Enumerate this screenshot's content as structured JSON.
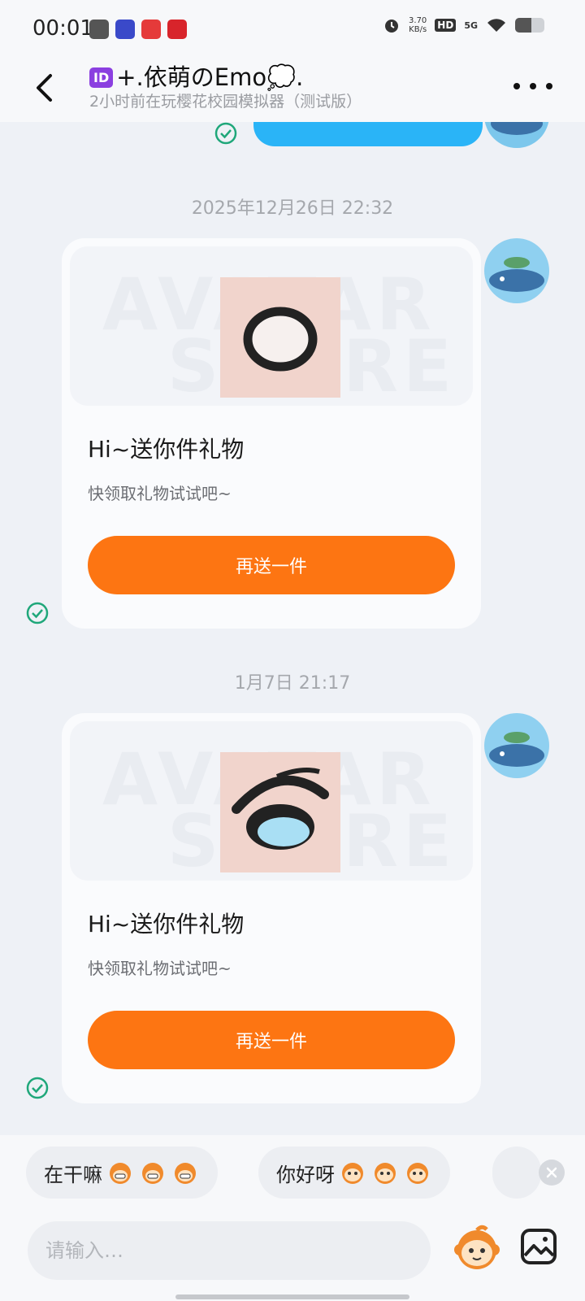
{
  "status_bar": {
    "time": "00:01",
    "net_speed_value": "3.70",
    "net_speed_unit": "KB/s",
    "hd": "HD",
    "signal": "5G",
    "battery_level": 0.55
  },
  "header": {
    "id_badge": "ID",
    "title": "+.依萌のEmo💭.",
    "subtitle": "2小时前在玩樱花校园模拟器（测试版）"
  },
  "messages": [
    {
      "timestamp": "2025年12月26日 22:32",
      "watermark": [
        "AVATAR",
        "STORE"
      ],
      "title": "Hi~送你件礼物",
      "desc": "快领取礼物试试吧~",
      "button": "再送一件"
    },
    {
      "timestamp": "1月7日 21:17",
      "watermark": [
        "AVATAR",
        "STORE"
      ],
      "title": "Hi~送你件礼物",
      "desc": "快领取礼物试试吧~",
      "button": "再送一件"
    }
  ],
  "quick_replies": [
    {
      "text": "在干嘛",
      "emoji": "grinning-monkey-icon"
    },
    {
      "text": "你好呀",
      "emoji": "cute-monkey-icon"
    }
  ],
  "input": {
    "placeholder": "请输入…"
  },
  "colors": {
    "accent": "#fd7512",
    "bubble": "#2ab4f7",
    "check": "#1fa77a",
    "background": "#eef1f6"
  }
}
